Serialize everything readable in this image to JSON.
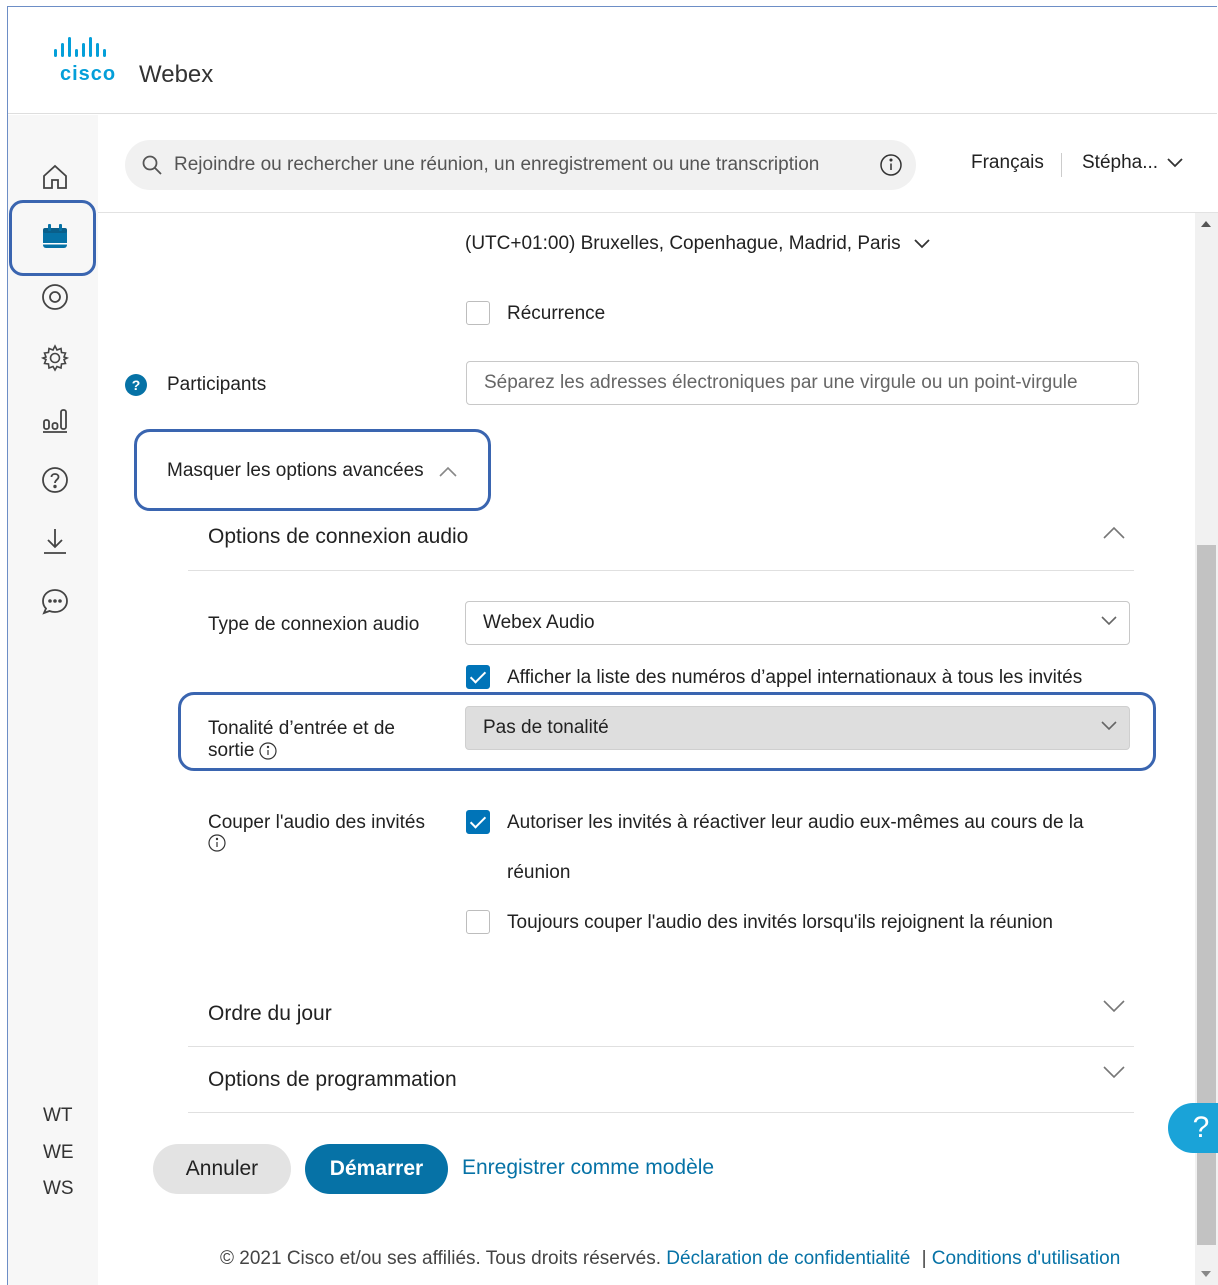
{
  "app": {
    "brand": "cisco",
    "product": "Webex"
  },
  "colors": {
    "accent": "#0672a6",
    "brand_blue": "#049fd9",
    "highlight_outline": "#3a65b0",
    "checkbox_checked": "#0074b8"
  },
  "sidebar": {
    "icons": [
      "home-icon",
      "calendar-icon",
      "recordings-icon",
      "gear-icon",
      "insights-icon",
      "help-icon",
      "download-icon",
      "chat-icon"
    ],
    "initials": [
      "WT",
      "WE",
      "WS"
    ]
  },
  "topbar": {
    "search_placeholder": "Rejoindre ou rechercher une réunion, un enregistrement ou une transcription",
    "language": "Français",
    "user": "Stépha..."
  },
  "form": {
    "timezone": "(UTC+01:00) Bruxelles, Copenhague, Madrid, Paris",
    "recurrence_label": "Récurrence",
    "recurrence_checked": false,
    "participants_label": "Participants",
    "participants_placeholder": "Séparez les adresses électroniques par une virgule ou un point-virgule",
    "advanced_toggle": "Masquer les options avancées",
    "audio_section": {
      "title": "Options de connexion audio",
      "type_label": "Type de connexion audio",
      "type_value": "Webex Audio",
      "show_intl_label": "Afficher la liste des numéros d’appel internationaux à tous les invités",
      "show_intl_checked": true,
      "tone_label_line1": "Tonalité d’entrée et de",
      "tone_label_line2": "sortie",
      "tone_value": "Pas de tonalité",
      "mute_label": "Couper l'audio des invités",
      "allow_unmute_line1": "Autoriser les invités à réactiver leur audio eux-mêmes au cours de la",
      "allow_unmute_line2": "réunion",
      "allow_unmute_checked": true,
      "always_mute_label": "Toujours couper l'audio des invités lorsqu'ils rejoignent la réunion",
      "always_mute_checked": false
    },
    "agenda_title": "Ordre du jour",
    "scheduling_title": "Options de programmation"
  },
  "actions": {
    "cancel": "Annuler",
    "start": "Démarrer",
    "save_template": "Enregistrer comme modèle"
  },
  "help_fab": "?",
  "footer": {
    "copyright": "© 2021 Cisco et/ou ses affiliés. Tous droits réservés.",
    "privacy": "Déclaration de confidentialité",
    "separator": "|",
    "terms": "Conditions d'utilisation"
  }
}
